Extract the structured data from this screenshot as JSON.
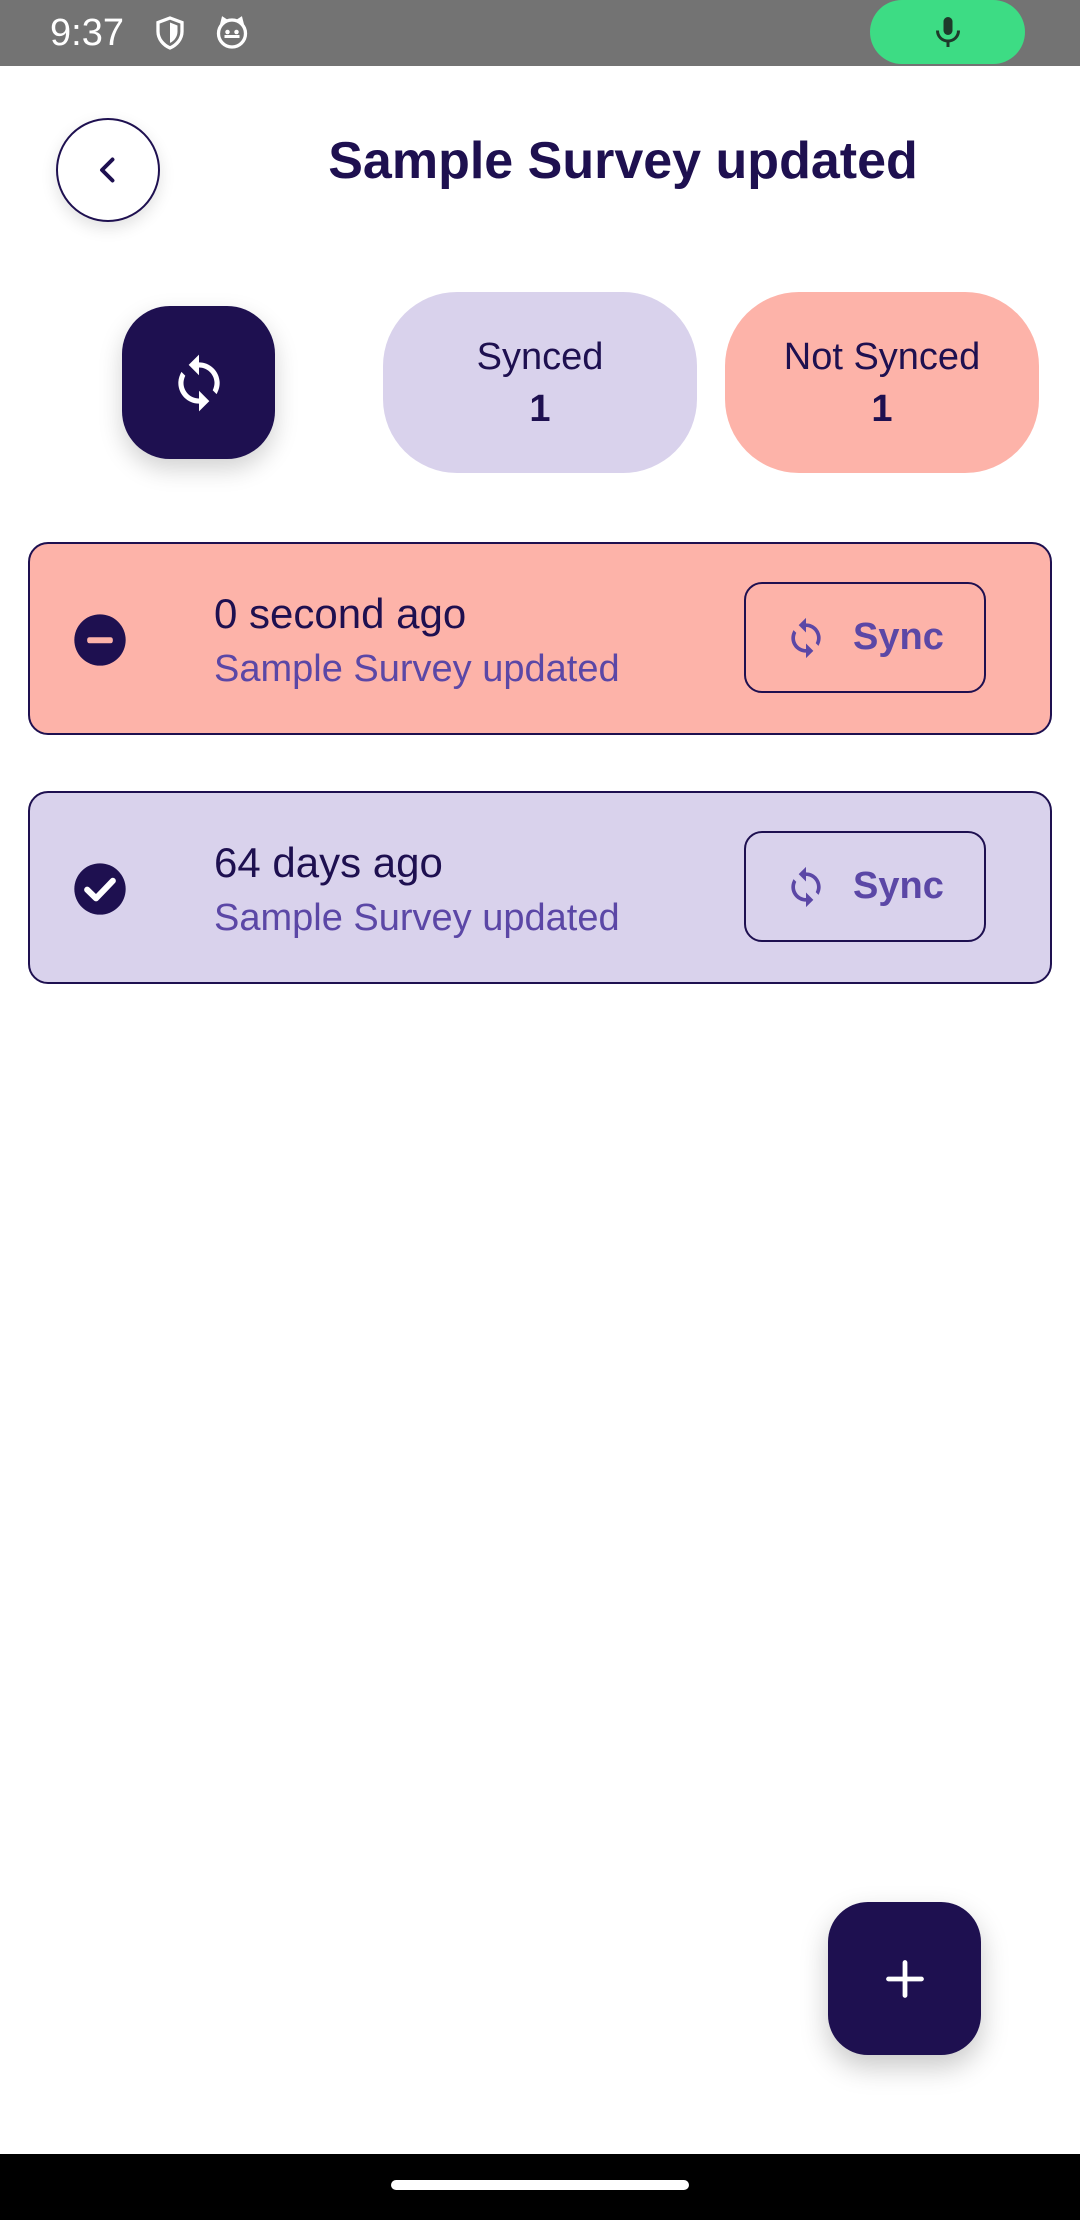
{
  "status_bar": {
    "time": "9:37",
    "icons": [
      "shield-icon",
      "cat-face-icon",
      "microphone-icon"
    ],
    "mic_color": "#3ddc84"
  },
  "header": {
    "back_icon": "chevron-left-icon",
    "title": "Sample Survey updated"
  },
  "summary": {
    "sync_all_icon": "sync-icon",
    "synced": {
      "label": "Synced",
      "count": "1",
      "color": "#d9d2ec"
    },
    "not_synced": {
      "label": "Not Synced",
      "count": "1",
      "color": "#fdb3a9"
    }
  },
  "records": [
    {
      "status": "not-synced",
      "status_icon": "minus-circle-icon",
      "time": "0 second ago",
      "survey": "Sample Survey updated",
      "button_label": "Sync",
      "button_icon": "sync-icon"
    },
    {
      "status": "synced",
      "status_icon": "check-circle-icon",
      "time": "64 days ago",
      "survey": "Sample Survey updated",
      "button_label": "Sync",
      "button_icon": "sync-icon"
    }
  ],
  "fab": {
    "icon": "plus-icon"
  },
  "colors": {
    "primary": "#1e1050",
    "accent_text": "#5b47a6",
    "synced_bg": "#d9d2ec",
    "not_synced_bg": "#fdb3a9"
  }
}
